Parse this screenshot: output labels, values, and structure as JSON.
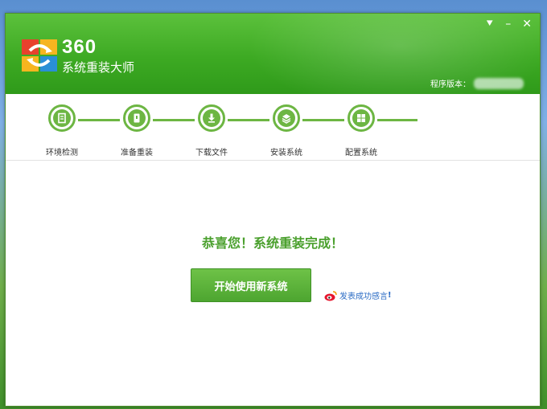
{
  "app": {
    "logo_number": "360",
    "logo_name": "系统重装大师",
    "version_label": "程序版本："
  },
  "window_controls": {
    "menu_glyph": "⯆",
    "minimize_glyph": "–",
    "close_glyph": "✕"
  },
  "steps": [
    {
      "label": "环境检测",
      "icon": "document-check-icon"
    },
    {
      "label": "准备重装",
      "icon": "backup-icon"
    },
    {
      "label": "下载文件",
      "icon": "download-icon"
    },
    {
      "label": "安装系统",
      "icon": "install-layers-icon"
    },
    {
      "label": "配置系统",
      "icon": "windows-config-icon"
    }
  ],
  "main": {
    "success_message": "恭喜您！系统重装完成！",
    "start_button_label": "开始使用新系统",
    "feedback_link": "发表成功感言",
    "feedback_suffix": "!"
  },
  "colors": {
    "brand_green": "#3daa23",
    "step_green": "#6db643",
    "success_text": "#4aa02d",
    "link_blue": "#2a6bc4"
  }
}
